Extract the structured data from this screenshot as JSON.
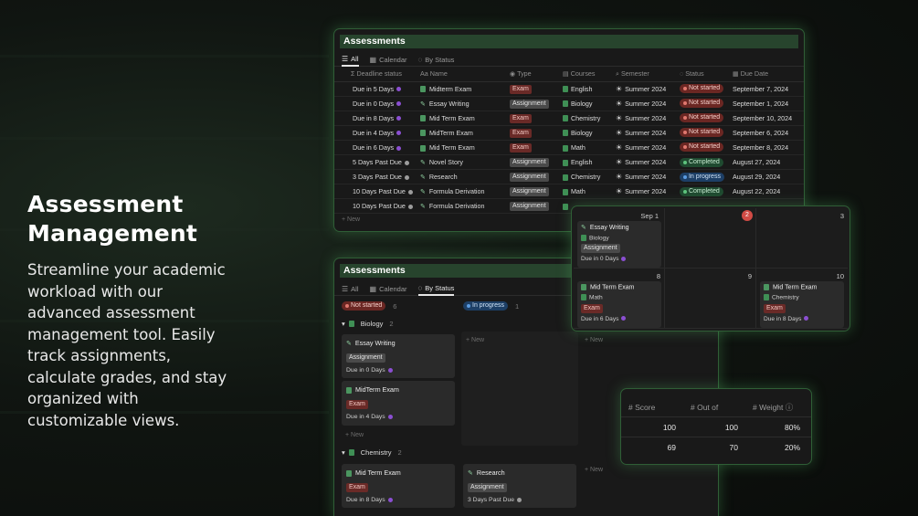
{
  "hero": {
    "title_line1": "Assessment",
    "title_line2": "Management",
    "description": "Streamline your academic workload with our advanced assessment management tool. Easily track assignments, calculate grades, and stay organized with customizable views."
  },
  "table_panel": {
    "title": "Assessments",
    "tabs": [
      {
        "label": "All",
        "icon": "list-icon"
      },
      {
        "label": "Calendar",
        "icon": "calendar-icon"
      },
      {
        "label": "By Status",
        "icon": "status-icon"
      }
    ],
    "columns": [
      "Deadline status",
      "Name",
      "Type",
      "Courses",
      "Semester",
      "Status",
      "Due Date"
    ],
    "rows": [
      {
        "deadline": "Due in 5 Days",
        "name": "Midterm Exam",
        "type": "Exam",
        "course": "English",
        "semester": "Summer 2024",
        "status": "Not started",
        "due": "September 7, 2024"
      },
      {
        "deadline": "Due in 0 Days",
        "name": "Essay Writing",
        "type": "Assignment",
        "course": "Biology",
        "semester": "Summer 2024",
        "status": "Not started",
        "due": "September 1, 2024"
      },
      {
        "deadline": "Due in 8 Days",
        "name": "Mid Term Exam",
        "type": "Exam",
        "course": "Chemistry",
        "semester": "Summer 2024",
        "status": "Not started",
        "due": "September 10, 2024"
      },
      {
        "deadline": "Due in 4 Days",
        "name": "MidTerm Exam",
        "type": "Exam",
        "course": "Biology",
        "semester": "Summer 2024",
        "status": "Not started",
        "due": "September 6, 2024"
      },
      {
        "deadline": "Due in 6 Days",
        "name": "Mid Term Exam",
        "type": "Exam",
        "course": "Math",
        "semester": "Summer 2024",
        "status": "Not started",
        "due": "September 8, 2024"
      },
      {
        "deadline": "5 Days Past Due",
        "name": "Novel Story",
        "type": "Assignment",
        "course": "English",
        "semester": "Summer 2024",
        "status": "Completed",
        "due": "August 27, 2024"
      },
      {
        "deadline": "3 Days Past Due",
        "name": "Research",
        "type": "Assignment",
        "course": "Chemistry",
        "semester": "Summer 2024",
        "status": "In progress",
        "due": "August 29, 2024"
      },
      {
        "deadline": "10 Days Past Due",
        "name": "Formula Derivation",
        "type": "Assignment",
        "course": "Math",
        "semester": "Summer 2024",
        "status": "Completed",
        "due": "August 22, 2024"
      },
      {
        "deadline": "10 Days Past Due",
        "name": "Formula Derivation",
        "type": "Assignment",
        "course": "",
        "semester": "",
        "status": "",
        "due": ""
      }
    ],
    "new_label": "+ New"
  },
  "board_panel": {
    "title": "Assessments",
    "tabs": [
      {
        "label": "All",
        "icon": "list-icon"
      },
      {
        "label": "Calendar",
        "icon": "calendar-icon"
      },
      {
        "label": "By Status",
        "icon": "status-icon"
      }
    ],
    "columns": [
      {
        "label": "Not started",
        "count": "6"
      },
      {
        "label": "In progress",
        "count": "1"
      }
    ],
    "groups": [
      {
        "label": "Biology",
        "count": "2"
      },
      {
        "label": "Chemistry",
        "count": "2"
      }
    ],
    "cards": [
      {
        "title": "Essay Writing",
        "tag": "Assignment",
        "due": "Due in 0 Days"
      },
      {
        "title": "MidTerm Exam",
        "tag": "Exam",
        "due": "Due in 4 Days"
      },
      {
        "title": "Mid Term Exam",
        "tag": "Exam",
        "due": "Due in 8 Days"
      },
      {
        "title": "Research",
        "tag": "Assignment",
        "due": "3 Days Past Due"
      }
    ],
    "new_label": "+ New"
  },
  "calendar_panel": {
    "days": [
      "Sep 1",
      "2",
      "3",
      "8",
      "9",
      "10"
    ],
    "events": [
      {
        "title": "Essay Writing",
        "course": "Biology",
        "tag": "Assignment",
        "due": "Due in 0 Days"
      },
      {
        "title": "Mid Term Exam",
        "course": "Math",
        "tag": "Exam",
        "due": "Due in 6 Days"
      },
      {
        "title": "Mid Term Exam",
        "course": "Chemistry",
        "tag": "Exam",
        "due": "Due in 8 Days"
      }
    ]
  },
  "grades_panel": {
    "columns": [
      "Score",
      "Out of",
      "Weight"
    ],
    "rows": [
      {
        "score": "100",
        "out_of": "100",
        "weight": "80%"
      },
      {
        "score": "69",
        "out_of": "70",
        "weight": "20%"
      }
    ]
  },
  "colors": {
    "accent": "#4aa05a",
    "exam_tag": "#6a2a27",
    "not_started": "#6b2723",
    "in_progress": "#1d3f66",
    "completed": "#1f4a30"
  }
}
